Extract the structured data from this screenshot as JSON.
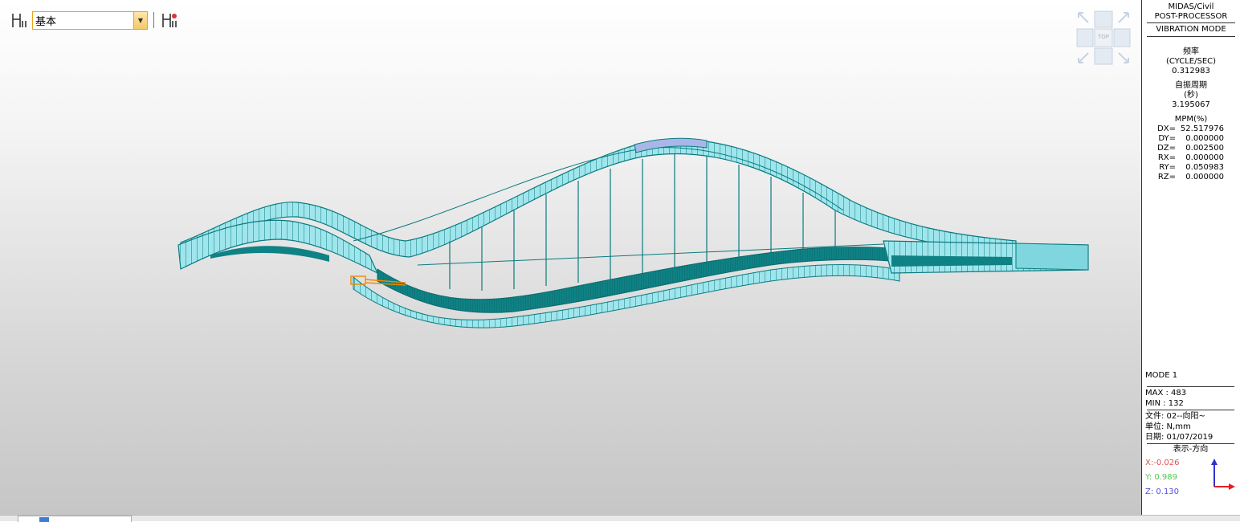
{
  "toolbar": {
    "layer_value": "基本"
  },
  "viewcube": {
    "face_label": "TOP"
  },
  "side_panel": {
    "title1": "MIDAS/Civil",
    "title2": "POST-PROCESSOR",
    "mode_title": "VIBRATION MODE",
    "freq_label": "频率",
    "freq_unit": "(CYCLE/SEC)",
    "freq_value": "0.312983",
    "period_label": "自振周期",
    "period_unit": "(秒)",
    "period_value": "3.195067",
    "mpm_label": "MPM(%)",
    "mpm": [
      {
        "k": "DX=",
        "v": "52.517976"
      },
      {
        "k": "DY=",
        "v": "0.000000"
      },
      {
        "k": "DZ=",
        "v": "0.002500"
      },
      {
        "k": "RX=",
        "v": "0.000000"
      },
      {
        "k": "RY=",
        "v": "0.050983"
      },
      {
        "k": "RZ=",
        "v": "0.000000"
      }
    ],
    "mode": "MODE 1",
    "max": "MAX : 483",
    "min": "MIN : 132",
    "file": "文件: 02--向阳~",
    "unit": "单位: N,mm",
    "date": "日期: 01/07/2019",
    "direction_label": "表示-方向",
    "x_dir": "X:-0.026",
    "y_dir": "Y: 0.989",
    "z_dir": "Z: 0.130"
  },
  "colors": {
    "model_fill": "#9fe6ec",
    "model_line": "#0a7a7f",
    "select_border": "#e8a317",
    "x_color": "#e05050",
    "y_color": "#50c850",
    "z_color": "#5050e0"
  }
}
